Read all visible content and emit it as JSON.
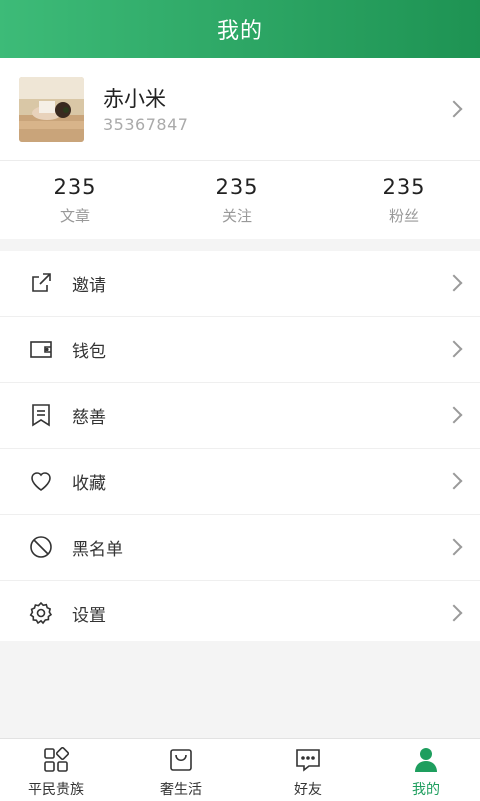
{
  "header": {
    "title": "我的"
  },
  "profile": {
    "name": "赤小米",
    "uid": "35367847"
  },
  "stats": [
    {
      "value": "235",
      "label": "文章"
    },
    {
      "value": "235",
      "label": "关注"
    },
    {
      "value": "235",
      "label": "粉丝"
    }
  ],
  "menu": [
    {
      "label": "邀请",
      "icon": "share-icon"
    },
    {
      "label": "钱包",
      "icon": "wallet-icon"
    },
    {
      "label": "慈善",
      "icon": "charity-bookmark-icon"
    },
    {
      "label": "收藏",
      "icon": "heart-icon"
    },
    {
      "label": "黑名单",
      "icon": "block-icon"
    },
    {
      "label": "设置",
      "icon": "gear-icon"
    }
  ],
  "tabs": [
    {
      "label": "平民贵族",
      "icon": "grid-icon"
    },
    {
      "label": "奢生活",
      "icon": "shopping-bag-icon"
    },
    {
      "label": "好友",
      "icon": "chat-icon"
    },
    {
      "label": "我的",
      "icon": "person-icon",
      "active": true
    }
  ],
  "colors": {
    "accent": "#1e9e5e",
    "header_start": "#3dbb78",
    "header_end": "#1e9353"
  }
}
